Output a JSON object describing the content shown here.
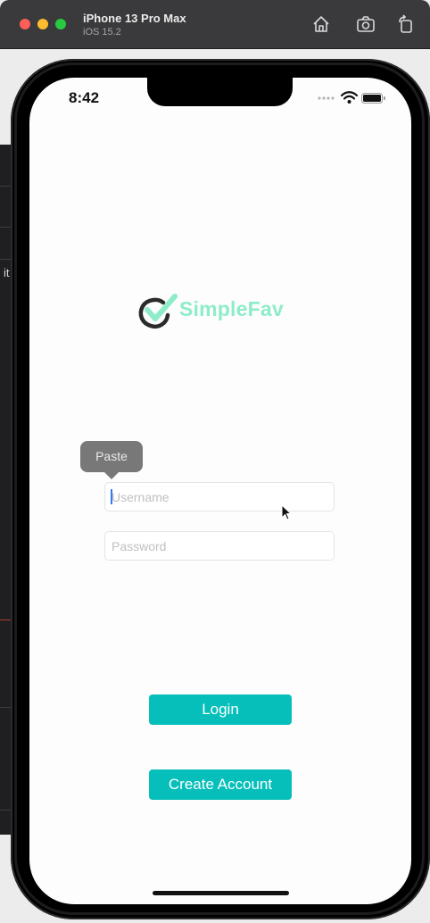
{
  "window": {
    "title": "iPhone 13 Pro Max",
    "subtitle": "iOS 15.2",
    "toolbar_icons": [
      "home-icon",
      "screenshot-icon",
      "rotate-icon"
    ]
  },
  "background": {
    "partial_text": "it"
  },
  "status_bar": {
    "time": "8:42",
    "icons": [
      "signal-dots-icon",
      "wifi-icon",
      "battery-icon"
    ]
  },
  "logo": {
    "text": "SimpleFav",
    "text_color": "#8eecc9",
    "check_color": "#8eecc9",
    "ring_color": "#2b2b2b"
  },
  "edit_menu": {
    "paste_label": "Paste"
  },
  "login_form": {
    "username_placeholder": "Username",
    "username_value": "",
    "password_placeholder": "Password",
    "password_value": "",
    "login_label": "Login",
    "create_account_label": "Create Account",
    "button_color": "#06bfba"
  }
}
